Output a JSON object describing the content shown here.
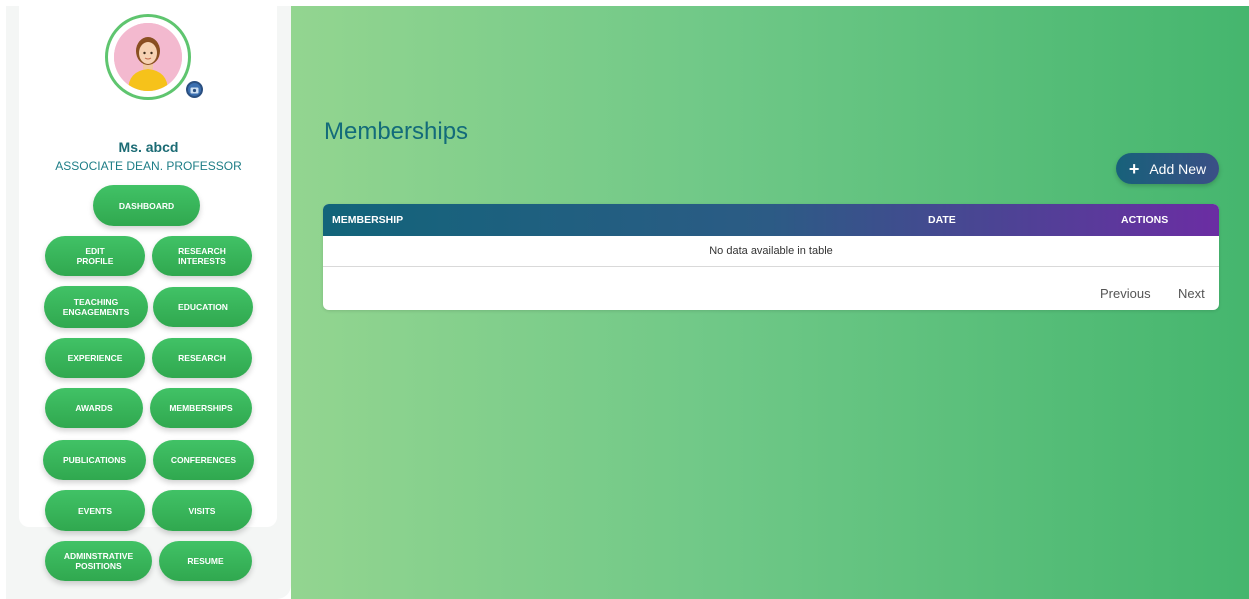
{
  "profile": {
    "name": "Ms. abcd",
    "role": "ASSOCIATE DEAN. PROFESSOR"
  },
  "nav": {
    "dashboard": "DASHBOARD",
    "edit_profile": "EDIT\nPROFILE",
    "research_interests": "RESEARCH\nINTERESTS",
    "teaching_engagements": "TEACHING\nENGAGEMENTS",
    "education": "EDUCATION",
    "experience": "EXPERIENCE",
    "research": "RESEARCH",
    "awards": "AWARDS",
    "memberships": "MEMBERSHIPS",
    "publications": "PUBLICATIONS",
    "conferences": "CONFERENCES",
    "events": "EVENTS",
    "visits": "VISITS",
    "administrative_positions": "ADMINSTRATIVE\nPOSITIONS",
    "resume": "RESUME"
  },
  "main": {
    "title": "Memberships",
    "add_button": "Add New",
    "table": {
      "columns": [
        "MEMBERSHIP",
        "DATE",
        "ACTIONS"
      ],
      "empty_message": "No data available in table"
    },
    "pagination": {
      "previous": "Previous",
      "next": "Next"
    }
  },
  "colors": {
    "accent_green": "#41c266",
    "title_teal": "#136b7a",
    "header_start": "#12647a",
    "header_end": "#6b2da3"
  },
  "icons": {
    "avatar": "woman-avatar",
    "camera": "camera-icon",
    "add": "plus-icon"
  }
}
